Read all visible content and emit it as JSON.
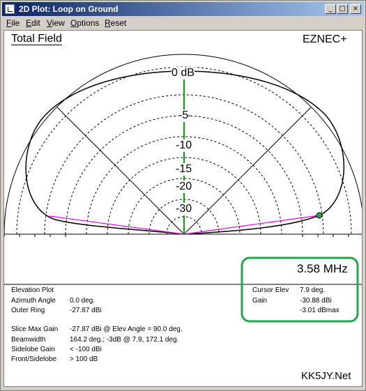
{
  "window": {
    "title": "2D Plot: Loop on Ground"
  },
  "title_buttons": {
    "minimize": "_",
    "maximize": "□",
    "close": "×"
  },
  "menu": [
    {
      "underlined": "F",
      "rest": "ile"
    },
    {
      "underlined": "E",
      "rest": "dit"
    },
    {
      "underlined": "V",
      "rest": "iew"
    },
    {
      "underlined": "O",
      "rest": "ptions"
    },
    {
      "underlined": "R",
      "rest": "eset"
    }
  ],
  "plot": {
    "heading": "Total Field",
    "brand": "EZNEC+",
    "ring_labels": [
      "0 dB",
      "-5",
      "-10",
      "-15",
      "-20",
      "-30"
    ],
    "frequency": "3.58 MHz",
    "watermark": "KK5JY.Net",
    "colors": {
      "highlight": "#22a84a",
      "axis": "#00aa00",
      "cursor": "#e000e0",
      "pattern": "#000000"
    }
  },
  "info_left": [
    {
      "label": "Elevation Plot",
      "value": ""
    },
    {
      "label": "Azimuth Angle",
      "value": "0.0 deg."
    },
    {
      "label": "Outer Ring",
      "value": "-27.87 dBi"
    },
    {
      "label": "Slice Max Gain",
      "value": "-27.87 dBi @ Elev Angle = 90.0 deg."
    },
    {
      "label": "Beamwidth",
      "value": "164.2 deg.; -3dB @ 7.9, 172.1 deg."
    },
    {
      "label": "Sidelobe Gain",
      "value": "< -100 dBi"
    },
    {
      "label": "Front/Sidelobe",
      "value": "> 100 dB"
    }
  ],
  "info_right": [
    {
      "label": "Cursor Elev",
      "value": "7.9 deg."
    },
    {
      "label": "Gain",
      "value": "-30.88 dBi"
    },
    {
      "label": "",
      "value": "-3.01 dBmax"
    }
  ]
}
